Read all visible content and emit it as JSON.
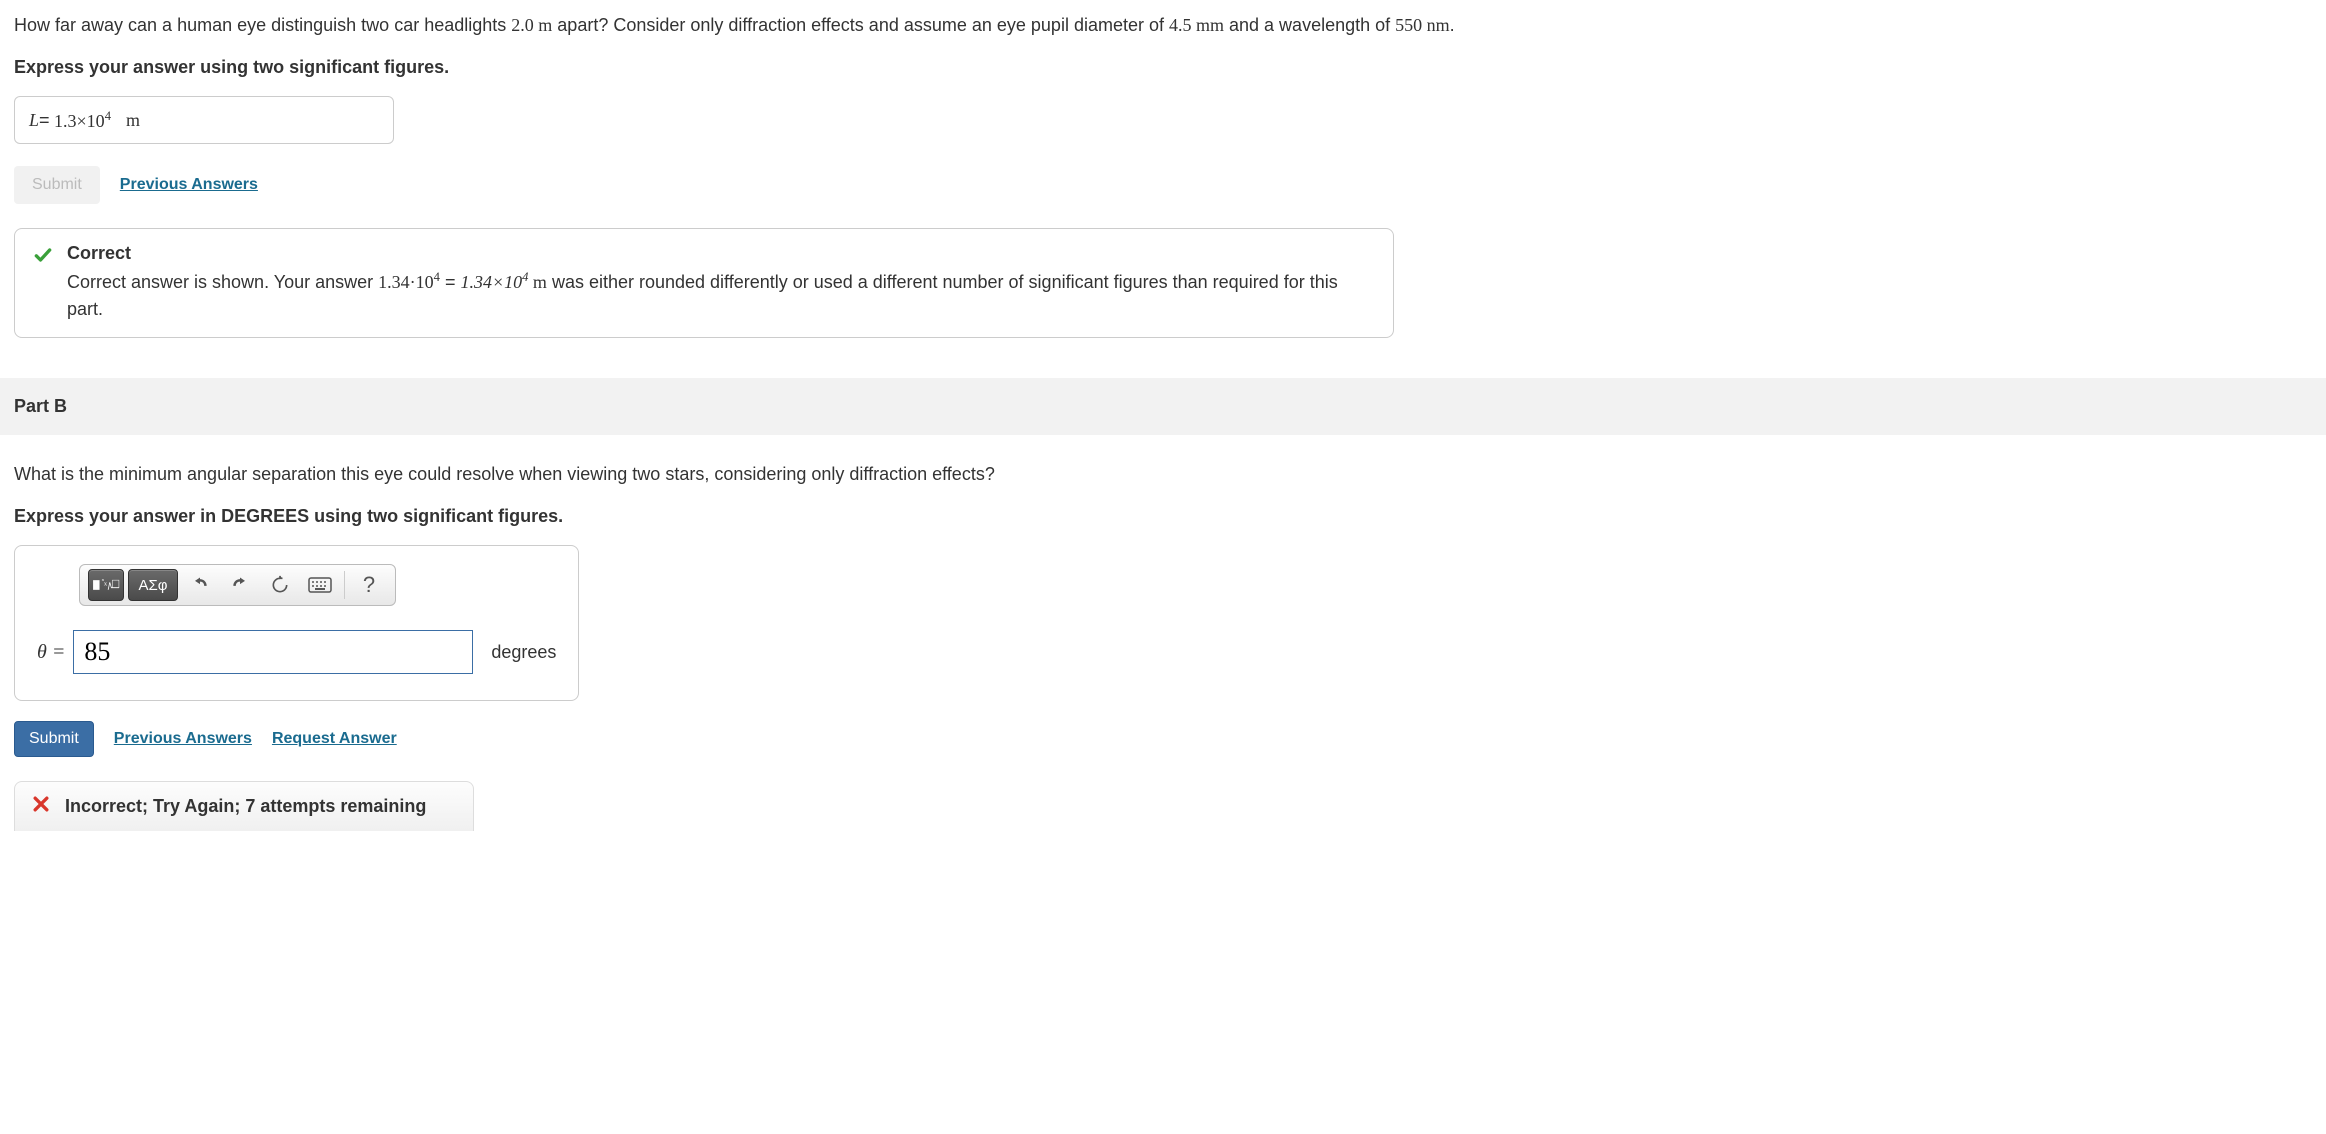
{
  "partA": {
    "question_prefix": "How far away can a human eye distinguish two car headlights ",
    "val1": "2.0 m",
    "question_mid1": " apart? Consider only diffraction effects and assume an eye pupil diameter of ",
    "val2": "4.5 mm",
    "question_mid2": " and a wavelength of ",
    "val3": "550 nm",
    "question_suffix": ".",
    "instruction": "Express your answer using two significant figures.",
    "variable": "L",
    "equals": " = ",
    "value_base": "1.3×10",
    "value_exp": "4",
    "unit": "m",
    "submit_label": "Submit",
    "prev_answers_label": "Previous Answers",
    "feedback_title": "Correct",
    "feedback_detail_prefix": "Correct answer is shown. Your answer ",
    "feedback_val1_base": "1.34·10",
    "feedback_val1_exp": "4",
    "feedback_eq": " = ",
    "feedback_val2_base": "1.34×10",
    "feedback_val2_exp": "4",
    "feedback_unit": " m",
    "feedback_detail_suffix": " was either rounded differently or used a different number of significant figures than required for this part."
  },
  "partB": {
    "header": "Part B",
    "question": "What is the minimum angular separation this eye could resolve when viewing two stars, considering only diffraction effects?",
    "instruction": "Express your answer in DEGREES using two significant figures.",
    "toolbar": {
      "templates_label": "■",
      "greek_label": "ΑΣφ",
      "help_label": "?"
    },
    "variable": "θ",
    "equals": " = ",
    "input_value": "85",
    "unit": "degrees",
    "submit_label": "Submit",
    "prev_answers_label": "Previous Answers",
    "request_answer_label": "Request Answer",
    "feedback_title": "Incorrect; Try Again; 7 attempts remaining"
  }
}
